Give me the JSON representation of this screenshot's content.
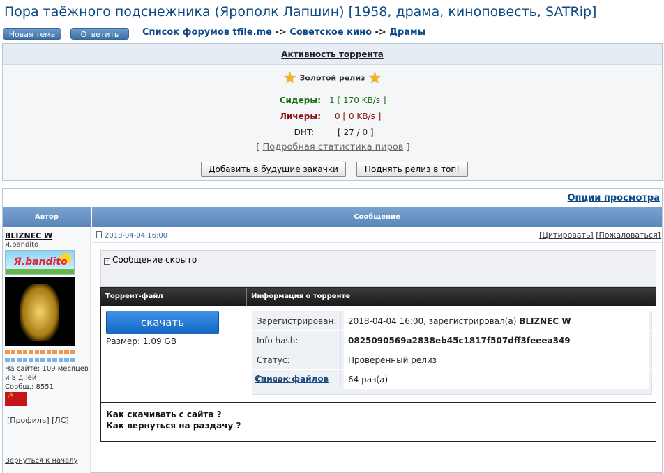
{
  "page": {
    "title": "Пора таёжного подснежника (Ярополк Лапшин) [1958, драма, киноповесть, SATRip]"
  },
  "toolbar": {
    "new_topic": "Новая тема",
    "reply": "Ответить"
  },
  "breadcrumb": {
    "root": "Список форумов tfile.me",
    "sep1": " -> ",
    "cat": "Советское кино",
    "sep2": " -> ",
    "sub": "Драмы"
  },
  "activity": {
    "title": "Активность торрента",
    "gold": "Золотой релиз",
    "seeders_label": "Сидеры:",
    "seeders_value": "1 [ 170 KB/s ]",
    "leechers_label": "Личеры:",
    "leechers_value": "0 [ 0 KB/s ]",
    "dht_label": "DHT:",
    "dht_value": "[ 27 / 0 ]",
    "stats_open": "[ ",
    "stats_link": "Подробная статистика пиров",
    "stats_close": " ]",
    "add_future": "Добавить в будущие закачки",
    "raise_top": "Поднять релиз в топ!"
  },
  "topic": {
    "view_options": "Опции просмотра",
    "col_author": "Автор",
    "col_message": "Сообщение"
  },
  "author": {
    "name": "BLIZNEC W",
    "rank": "Я.bandito",
    "badge_text": "Я.bandito",
    "online": "На сайте: 109 месяцев и 8 дней",
    "posts": "Сообщ.: 8551",
    "profile": "[Профиль]",
    "pm": "[ЛС]",
    "back_to_top": "Вернуться к началу"
  },
  "post": {
    "date": "2018-04-04 16:00",
    "quote": "[Цитировать]",
    "report": "[Пожаловаться]",
    "spoiler": "Сообщение скрыто"
  },
  "torrent": {
    "col_file": "Торрент-файл",
    "col_info": "Информация о торренте",
    "download": "скачать",
    "size": "Размер: 1.09 GB",
    "registered_label": "Зарегистрирован:",
    "registered_value": "2018-04-04 16:00, зарегистрировал(а)",
    "registered_by": "BLIZNEC W",
    "hash_label": "Info hash:",
    "hash_value": "0825090569a2838eb45c1817f507dff3feeea349",
    "status_label": "Статус:",
    "status_value": "Проверенный релиз",
    "downloaded_label": "Скачан:",
    "downloaded_value": "64 раз(а)",
    "file_list": "Список файлов",
    "howto_download": "Как скачивать с сайта ?",
    "howto_return": "Как вернуться на раздачу ?"
  }
}
